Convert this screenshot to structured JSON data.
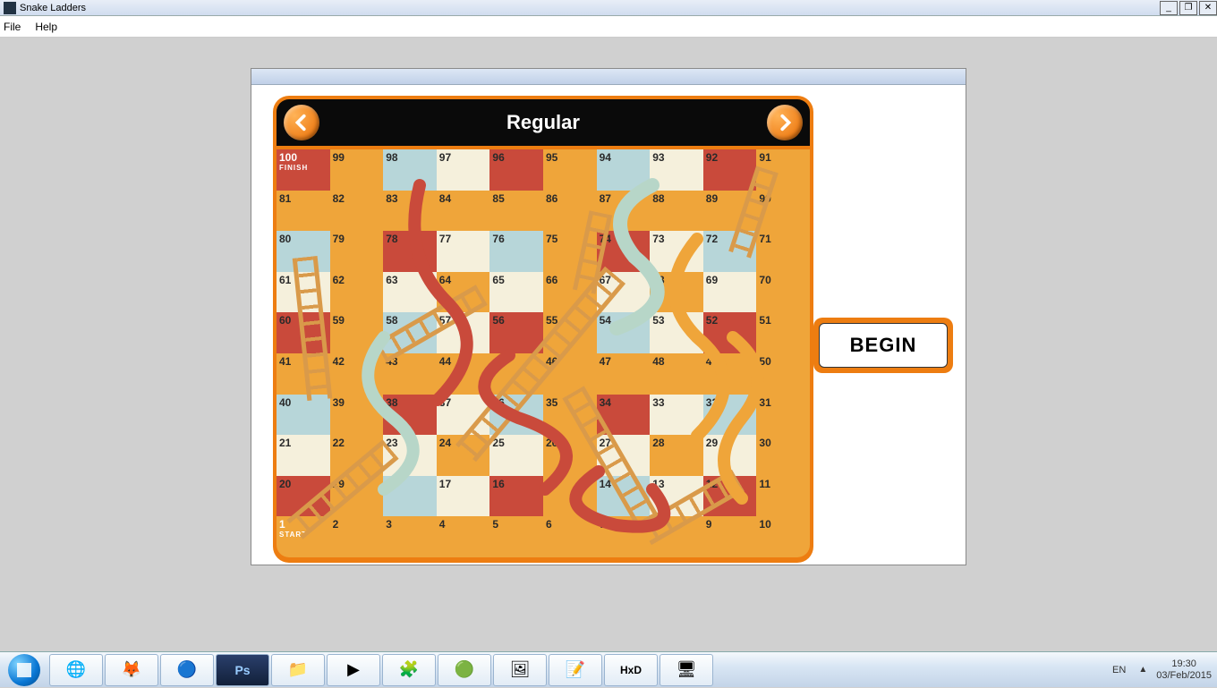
{
  "window": {
    "title": "Snake Ladders"
  },
  "menu": {
    "file": "File",
    "help": "Help"
  },
  "game": {
    "mode_title": "Regular",
    "begin_label": "BEGIN",
    "finish_label": "FINISH",
    "start_label": "START",
    "board_size": 100
  },
  "taskbar": {
    "language": "EN",
    "time": "19:30",
    "date": "03/Feb/2015"
  },
  "board_colors_note": "10x10 snakes-and-ladders board, cells colored red/cream/blue/orange in mixed pattern, numbered 1 (bottom-left START) to 100 (top-left FINISH) in boustrophedon order"
}
